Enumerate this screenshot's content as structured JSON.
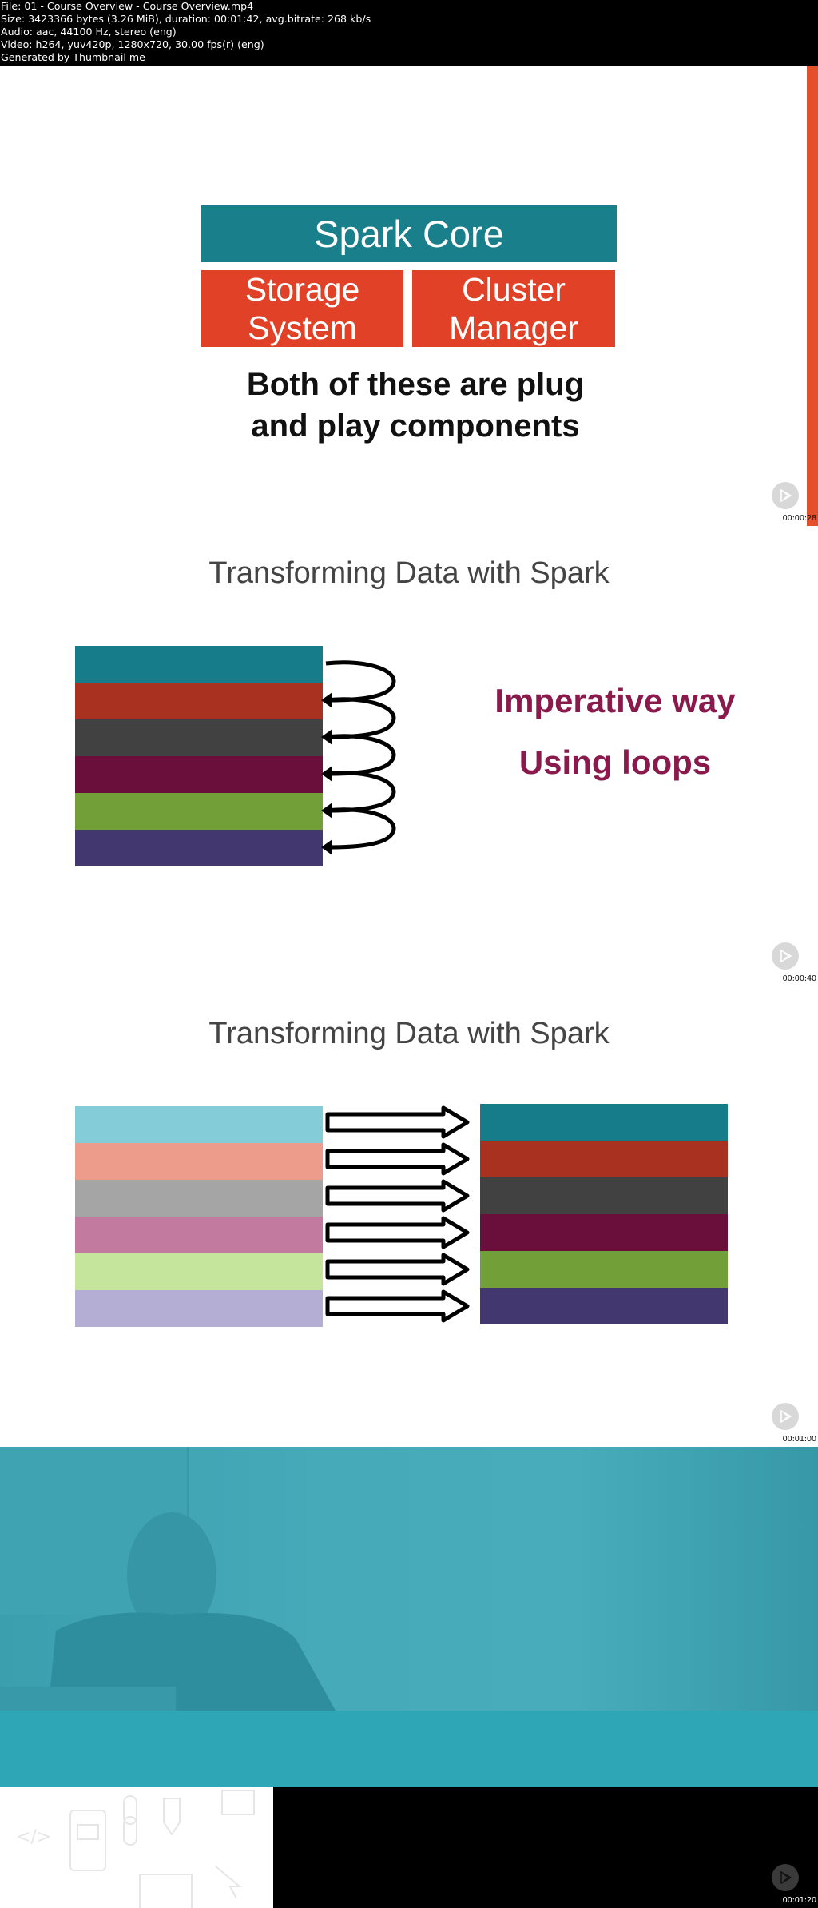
{
  "header": {
    "lines": [
      "File: 01 - Course Overview - Course Overview.mp4",
      "Size: 3423366 bytes (3.26 MiB), duration: 00:01:42, avg.bitrate: 268 kb/s",
      "Audio: aac, 44100 Hz, stereo (eng)",
      "Video: h264, yuv420p, 1280x720, 30.00 fps(r) (eng)",
      "Generated by Thumbnail me"
    ]
  },
  "colors": {
    "spark_core": "#197f8a",
    "component": "#e04127",
    "accent_bar": "#e3502b",
    "imperative_text": "#8a1a4c",
    "teal_band": "#2fa6b6"
  },
  "frames": [
    {
      "timestamp": "00:00:28",
      "spark_core_label": "Spark Core",
      "storage_label_1": "Storage",
      "storage_label_2": "System",
      "cluster_label_1": "Cluster",
      "cluster_label_2": "Manager",
      "caption_1": "Both of these are plug",
      "caption_2": "and play components"
    },
    {
      "timestamp": "00:00:40",
      "title": "Transforming Data with Spark",
      "stripes": [
        "#177c89",
        "#a8321f",
        "#414141",
        "#6a0f3b",
        "#739f38",
        "#42376e"
      ],
      "text_1": "Imperative way",
      "text_2": "Using loops"
    },
    {
      "timestamp": "00:01:00",
      "title": "Transforming Data with Spark",
      "input_stripes": [
        "#84cdd8",
        "#ed9b8a",
        "#a5a5a5",
        "#c27a9f",
        "#c6e59c",
        "#b4aed4"
      ],
      "output_stripes": [
        "#177c89",
        "#a8321f",
        "#414141",
        "#6a0f3b",
        "#739f38",
        "#42376e"
      ]
    },
    {
      "timestamp": "00:01:20"
    }
  ]
}
